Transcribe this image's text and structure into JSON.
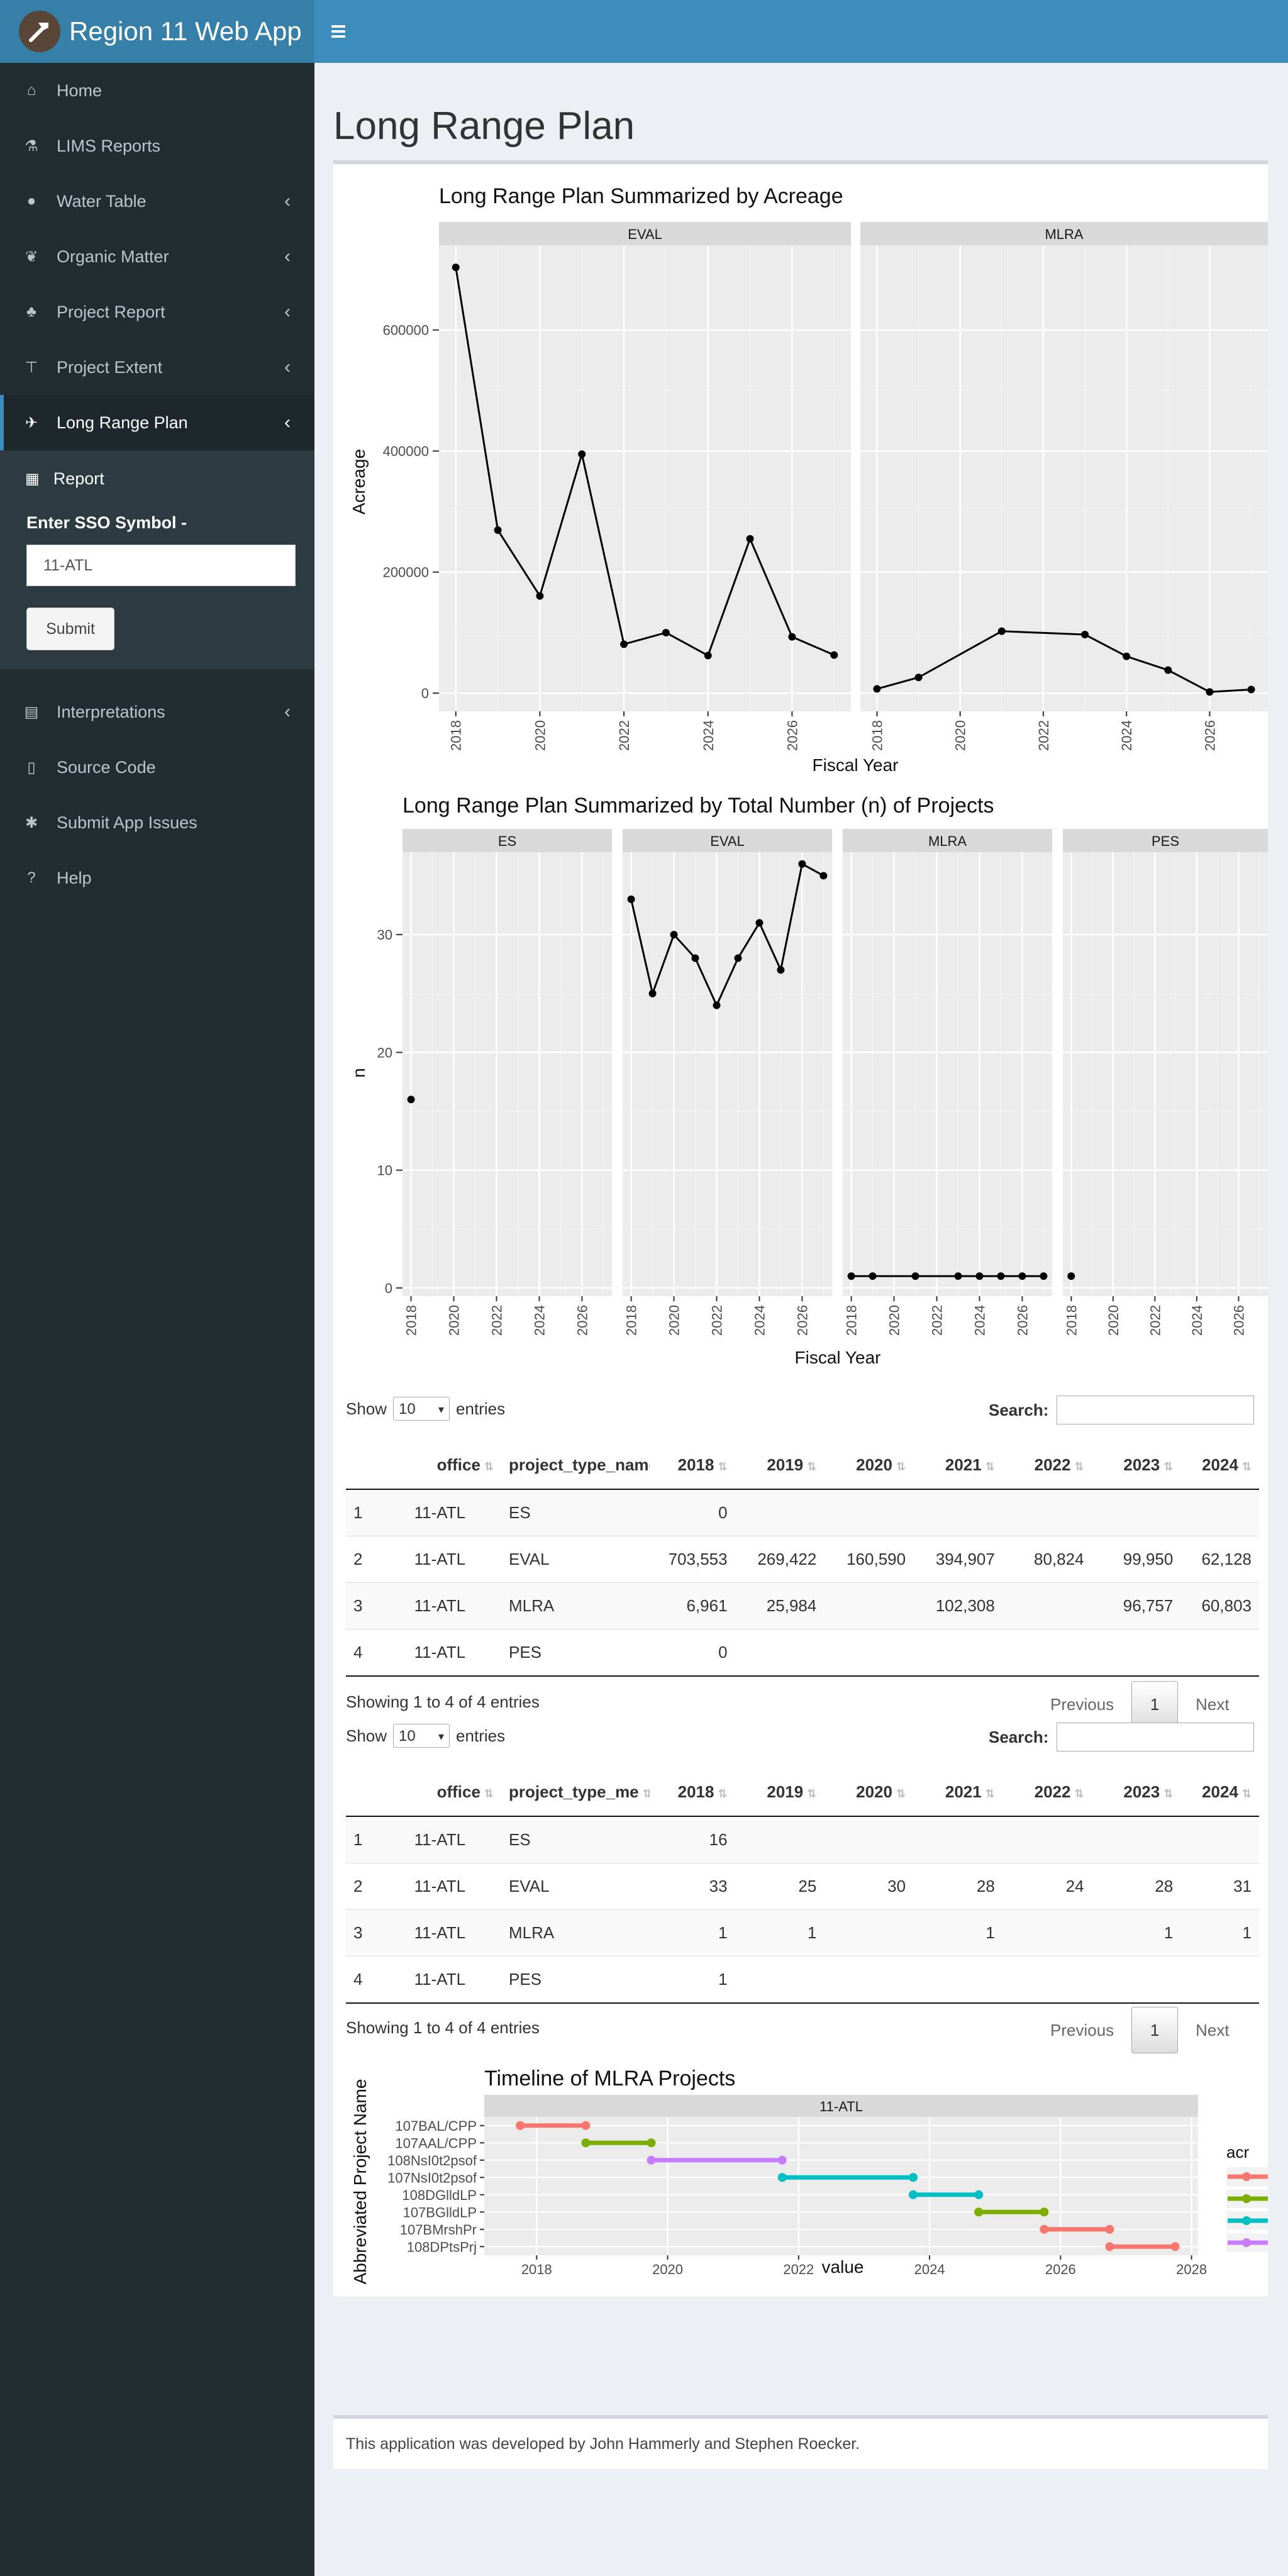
{
  "app": {
    "title": "Region 11 Web App"
  },
  "icons": {
    "logo": "hammer-logo-icon",
    "toggle": "hamburger-icon"
  },
  "sidebar": {
    "items": [
      {
        "label": "Home",
        "icon": "home-icon"
      },
      {
        "label": "LIMS Reports",
        "icon": "flask-icon"
      },
      {
        "label": "Water Table",
        "icon": "tint-icon"
      },
      {
        "label": "Organic Matter",
        "icon": "leaf-icon"
      },
      {
        "label": "Project Report",
        "icon": "seedling-icon"
      },
      {
        "label": "Project Extent",
        "icon": "signs-icon"
      },
      {
        "label": "Long Range Plan",
        "icon": "plane-icon"
      },
      {
        "label": "Interpretations",
        "icon": "archive-icon"
      },
      {
        "label": "Source Code",
        "icon": "code-file-icon"
      },
      {
        "label": "Submit App Issues",
        "icon": "bug-icon"
      },
      {
        "label": "Help",
        "icon": "question-icon"
      }
    ],
    "submenu": {
      "report_label": "Report",
      "input_label": "Enter SSO Symbol -",
      "input_value": "11-ATL",
      "submit_label": "Submit"
    }
  },
  "page": {
    "title": "Long Range Plan"
  },
  "colors": {
    "header": "#3c8dbc",
    "sidebar": "#222d32",
    "panel": "#ebebeb",
    "strip": "#d9d9d9",
    "red": "#f8766d",
    "green": "#7cae00",
    "teal": "#00bfc4",
    "purple": "#c77cff"
  },
  "chart_data": [
    {
      "type": "line",
      "title": "Long Range Plan Summarized by Acreage",
      "xlabel": "Fiscal Year",
      "ylabel": "Acreage",
      "ylim": [
        -30000,
        740000
      ],
      "yticks": [
        0,
        200000,
        400000,
        600000
      ],
      "ytick_labels": [
        "0",
        "200000",
        "400000",
        "600000"
      ],
      "xlim": [
        2017.6,
        2027.4
      ],
      "xticks": [
        2018,
        2020,
        2022,
        2024,
        2026
      ],
      "grid": true,
      "facets": [
        {
          "name": "EVAL",
          "x": [
            2018,
            2019,
            2020,
            2021,
            2022,
            2023,
            2024,
            2025,
            2026,
            2027
          ],
          "y": [
            703553,
            269422,
            160590,
            394907,
            80824,
            99950,
            62128,
            255000,
            93000,
            63000
          ]
        },
        {
          "name": "MLRA",
          "x": [
            2018,
            2019,
            2021,
            2023,
            2024,
            2025,
            2026,
            2027
          ],
          "y": [
            6961,
            25984,
            102308,
            96757,
            60803,
            38000,
            2000,
            6000
          ]
        }
      ]
    },
    {
      "type": "line",
      "title": "Long Range Plan Summarized by Total Number (n) of Projects",
      "xlabel": "Fiscal Year",
      "ylabel": "n",
      "ylim": [
        -0.7,
        37
      ],
      "yticks": [
        0,
        10,
        20,
        30
      ],
      "ytick_labels": [
        "0",
        "10",
        "20",
        "30"
      ],
      "xlim": [
        2017.6,
        2027.4
      ],
      "xticks": [
        2018,
        2020,
        2022,
        2024,
        2026
      ],
      "grid": true,
      "facets": [
        {
          "name": "ES",
          "x": [
            2018
          ],
          "y": [
            16
          ]
        },
        {
          "name": "EVAL",
          "x": [
            2018,
            2019,
            2020,
            2021,
            2022,
            2023,
            2024,
            2025,
            2026,
            2027
          ],
          "y": [
            33,
            25,
            30,
            28,
            24,
            28,
            31,
            27,
            36,
            35
          ]
        },
        {
          "name": "MLRA",
          "x": [
            2018,
            2019,
            2021,
            2023,
            2024,
            2025,
            2026,
            2027
          ],
          "y": [
            1,
            1,
            1,
            1,
            1,
            1,
            1,
            1
          ]
        },
        {
          "name": "PES",
          "x": [
            2018
          ],
          "y": [
            1
          ]
        }
      ]
    },
    {
      "type": "line",
      "title": "Timeline of MLRA Projects",
      "facet": "11-ATL",
      "xlabel": "value",
      "ylabel": "Abbreviated Project Name",
      "xlim": [
        2017.2,
        2028.1
      ],
      "xticks": [
        2018,
        2020,
        2022,
        2024,
        2026,
        2028
      ],
      "legend_title": "acr",
      "legend_placement": "right (clipped)",
      "series": [
        {
          "name": "107BAL/CPP",
          "start": 2017.75,
          "end": 2018.75,
          "color": "#f8766d"
        },
        {
          "name": "107AAL/CPP",
          "start": 2018.75,
          "end": 2019.75,
          "color": "#7cae00"
        },
        {
          "name": "108NsI0t2psof",
          "start": 2019.75,
          "end": 2021.75,
          "color": "#c77cff"
        },
        {
          "name": "107NsI0t2psof",
          "start": 2021.75,
          "end": 2023.75,
          "color": "#00bfc4"
        },
        {
          "name": "108DGlldLP",
          "start": 2023.75,
          "end": 2024.75,
          "color": "#00bfc4"
        },
        {
          "name": "107BGlldLP",
          "start": 2024.75,
          "end": 2025.75,
          "color": "#7cae00"
        },
        {
          "name": "107BMrshPr",
          "start": 2025.75,
          "end": 2026.75,
          "color": "#f8766d"
        },
        {
          "name": "108DPtsPrj",
          "start": 2026.75,
          "end": 2027.75,
          "color": "#f8766d"
        }
      ]
    }
  ],
  "tables": [
    {
      "show_label": "Show",
      "entries_label": "entries",
      "length_value": "10",
      "search_label": "Search:",
      "columns": [
        "",
        "office",
        "project_type_name",
        "2018",
        "2019",
        "2020",
        "2021",
        "2022",
        "2023",
        "2024"
      ],
      "rows": [
        [
          "1",
          "11-ATL",
          "ES",
          "0",
          "",
          "",
          "",
          "",
          "",
          ""
        ],
        [
          "2",
          "11-ATL",
          "EVAL",
          "703,553",
          "269,422",
          "160,590",
          "394,907",
          "80,824",
          "99,950",
          "62,128"
        ],
        [
          "3",
          "11-ATL",
          "MLRA",
          "6,961",
          "25,984",
          "",
          "102,308",
          "",
          "96,757",
          "60,803"
        ],
        [
          "4",
          "11-ATL",
          "PES",
          "0",
          "",
          "",
          "",
          "",
          "",
          ""
        ]
      ],
      "info": "Showing 1 to 4 of 4 entries",
      "previous": "Previous",
      "page": "1",
      "next": "Next"
    },
    {
      "show_label": "Show",
      "entries_label": "entries",
      "length_value": "10",
      "search_label": "Search:",
      "columns": [
        "",
        "office",
        "project_type_me",
        "2018",
        "2019",
        "2020",
        "2021",
        "2022",
        "2023",
        "2024"
      ],
      "rows": [
        [
          "1",
          "11-ATL",
          "ES",
          "16",
          "",
          "",
          "",
          "",
          "",
          ""
        ],
        [
          "2",
          "11-ATL",
          "EVAL",
          "33",
          "25",
          "30",
          "28",
          "24",
          "28",
          "31"
        ],
        [
          "3",
          "11-ATL",
          "MLRA",
          "1",
          "1",
          "",
          "1",
          "",
          "1",
          "1"
        ],
        [
          "4",
          "11-ATL",
          "PES",
          "1",
          "",
          "",
          "",
          "",
          "",
          ""
        ]
      ],
      "info": "Showing 1 to 4 of 4 entries",
      "previous": "Previous",
      "page": "1",
      "next": "Next"
    }
  ],
  "footer": {
    "text": "This application was developed by John Hammerly and Stephen Roecker."
  }
}
